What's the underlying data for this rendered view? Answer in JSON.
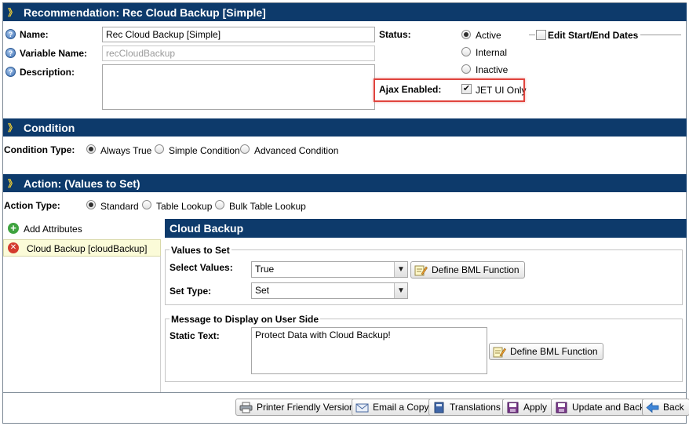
{
  "recommendation": {
    "header": "Recommendation: Rec Cloud Backup [Simple]",
    "name_label": "Name:",
    "name_value": "Rec Cloud Backup [Simple]",
    "variable_label": "Variable Name:",
    "variable_value": "recCloudBackup",
    "description_label": "Description:",
    "description_value": "",
    "status_label": "Status:",
    "status_options": [
      "Active",
      "Internal",
      "Inactive"
    ],
    "status_selected": "Active",
    "edit_dates_label": "Edit Start/End Dates",
    "ajax_label": "Ajax Enabled:",
    "ajax_checkbox_label": "JET UI Only",
    "ajax_checked": true
  },
  "condition": {
    "header": "Condition",
    "type_label": "Condition Type:",
    "options": [
      "Always True",
      "Simple Condition",
      "Advanced Condition"
    ],
    "selected": "Always True"
  },
  "action": {
    "header": "Action: (Values to Set)",
    "type_label": "Action Type:",
    "options": [
      "Standard",
      "Table Lookup",
      "Bulk Table Lookup"
    ],
    "selected": "Standard",
    "add_attributes": "Add Attributes",
    "attribute_item": "Cloud Backup [cloudBackup]"
  },
  "detail": {
    "header": "Cloud Backup",
    "values_legend": "Values to Set",
    "select_values_label": "Select Values:",
    "select_values_value": "True",
    "define_bml": "Define BML Function",
    "set_type_label": "Set Type:",
    "set_type_value": "Set",
    "message_legend": "Message to Display on User Side",
    "static_text_label": "Static Text:",
    "static_text_value": "Protect Data with Cloud Backup!"
  },
  "footer": {
    "printer": "Printer Friendly Version",
    "email": "Email a Copy",
    "translations": "Translations",
    "apply": "Apply",
    "update_back": "Update and Back",
    "back": "Back"
  },
  "colors": {
    "header_bg": "#0d3a6b",
    "chevron": "#f4d135",
    "highlight_box": "#e0443e",
    "selected_row": "#fbfbd8"
  }
}
